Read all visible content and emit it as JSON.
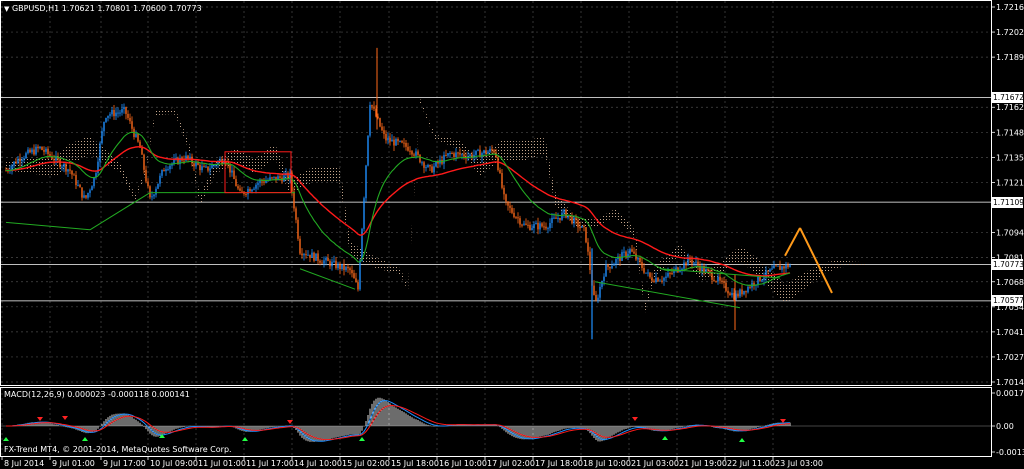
{
  "header": {
    "symbol_line": "GBPUSD,H1  1.70621 1.70801 1.70600 1.70773",
    "copyright": "FX-Trend MT4, © 2001-2014, MetaQuotes Software Corp."
  },
  "price_axis": {
    "ticks": [
      "1.72160",
      "1.72025",
      "1.71890",
      "1.71620",
      "1.71485",
      "1.71350",
      "1.71215",
      "1.70945",
      "1.70810",
      "1.70680",
      "1.70545",
      "1.70410",
      "1.70275",
      "1.70140"
    ],
    "labels": [
      {
        "text": "1.71672",
        "value": 1.71672
      },
      {
        "text": "1.71109",
        "value": 1.71109
      },
      {
        "text": "1.70773",
        "value": 1.70773
      },
      {
        "text": "1.70577",
        "value": 1.70577
      }
    ]
  },
  "macd": {
    "title": "MACD(12,26,9) 0.000023 -0.000118 0.000141",
    "ticks": [
      "0.001739",
      "0.00",
      "-0.001364"
    ]
  },
  "time_axis": {
    "labels": [
      "8 Jul 2014",
      "9 Jul 01:00",
      "9 Jul 17:00",
      "10 Jul 09:00",
      "11 Jul 01:00",
      "11 Jul 17:00",
      "14 Jul 10:00",
      "15 Jul 02:00",
      "15 Jul 18:00",
      "16 Jul 10:00",
      "17 Jul 02:00",
      "17 Jul 18:00",
      "18 Jul 10:00",
      "21 Jul 03:00",
      "21 Jul 19:00",
      "22 Jul 11:00",
      "23 Jul 03:00"
    ]
  },
  "colors": {
    "background": "#000000",
    "grid": "#4a4a4a",
    "bull": "#1e90ff",
    "bear": "#ff6a1a",
    "ma_red": "#ff1a1a",
    "ma_green": "#22aa22",
    "cloud": "#d9b79a",
    "forecast": "#ff9a1a"
  }
}
